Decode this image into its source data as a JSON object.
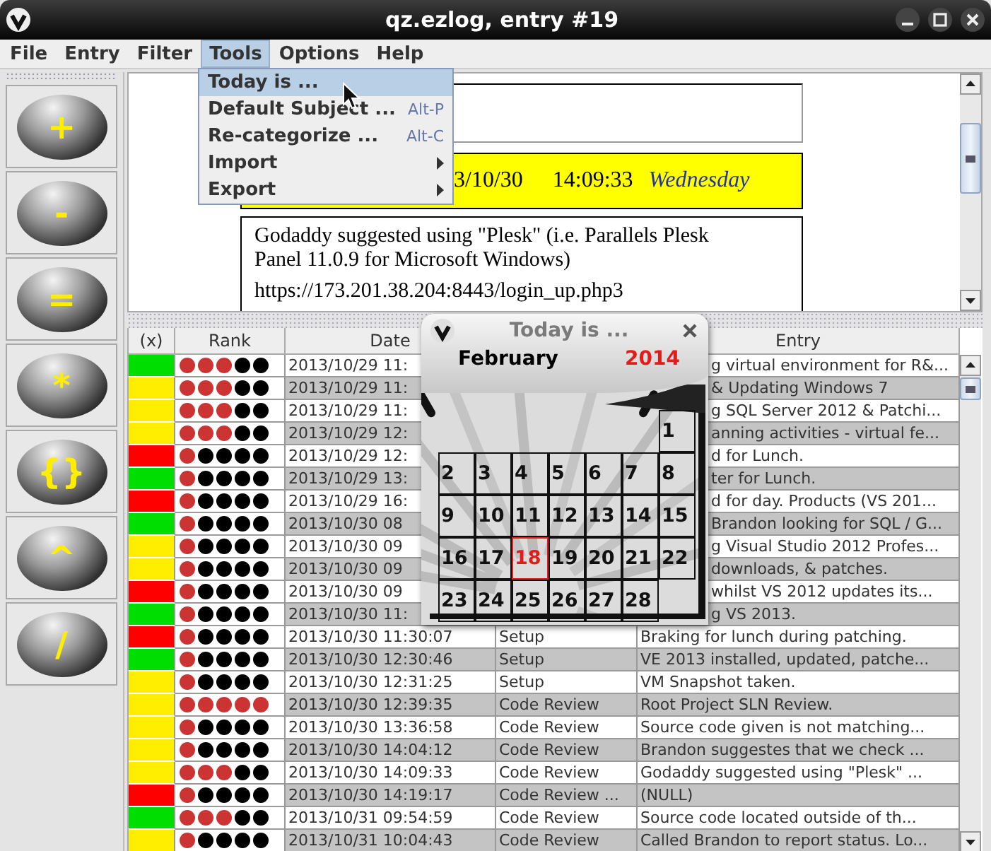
{
  "window": {
    "title": "qz.ezlog, entry #19"
  },
  "menu_bar": [
    {
      "label": "File",
      "selected": false
    },
    {
      "label": "Entry",
      "selected": false
    },
    {
      "label": "Filter",
      "selected": false
    },
    {
      "label": "Tools",
      "selected": true
    },
    {
      "label": "Options",
      "selected": false
    },
    {
      "label": "Help",
      "selected": false
    }
  ],
  "tools_menu": [
    {
      "label": "Today is ...",
      "selected": true,
      "submenu": false
    },
    {
      "label": "Default Subject ...",
      "shortcut": "Alt-P",
      "selected": false,
      "submenu": false
    },
    {
      "label": "Re-categorize ...",
      "shortcut": "Alt-C",
      "selected": false,
      "submenu": false
    },
    {
      "label": "Import",
      "selected": false,
      "submenu": true
    },
    {
      "label": "Export",
      "selected": false,
      "submenu": true
    }
  ],
  "toolbar": [
    "+",
    "-",
    "=",
    "*",
    "{}",
    "^",
    "/"
  ],
  "document": {
    "date": "3/10/30",
    "time": "14:09:33",
    "weekday": "Wednesday",
    "body": "Godaddy suggested using \"Plesk\" (i.e. Parallels Plesk Panel 11.0.9 for Microsoft Windows)",
    "link": "https://173.201.38.204:8443/login_up.php3"
  },
  "table": {
    "columns": [
      "(x)",
      "Rank",
      "Date",
      "Entry"
    ],
    "rows": [
      {
        "color": "#00dd00",
        "stars": 3,
        "date": "2013/10/29 11:",
        "entry": "g virtual environment for R&..."
      },
      {
        "color": "#ffee00",
        "stars": 3,
        "date": "2013/10/29 11:",
        "entry": "& Updating Windows 7"
      },
      {
        "color": "#ffee00",
        "stars": 3,
        "date": "2013/10/29 11:",
        "entry": "g SQL Server 2012 & Patchi..."
      },
      {
        "color": "#ffee00",
        "stars": 3,
        "date": "2013/10/29 12:",
        "entry": "anning activities - virtual fe..."
      },
      {
        "color": "#ff0000",
        "stars": 1,
        "date": "2013/10/29 12:",
        "entry": "d for Lunch."
      },
      {
        "color": "#00dd00",
        "stars": 1,
        "date": "2013/10/29 13:",
        "entry": "ter for Lunch."
      },
      {
        "color": "#ff0000",
        "stars": 1,
        "date": "2013/10/29 16:",
        "entry": "d for day. Products (VS 201..."
      },
      {
        "color": "#00dd00",
        "stars": 1,
        "date": "2013/10/30 08",
        "entry": "Brandon looking for SQL / G..."
      },
      {
        "color": "#ffee00",
        "stars": 1,
        "date": "2013/10/30 09",
        "entry": "g Visual Studio 2012 Profes..."
      },
      {
        "color": "#ffee00",
        "stars": 1,
        "date": "2013/10/30 09",
        "entry": "downloads, & patches."
      },
      {
        "color": "#ff0000",
        "stars": 1,
        "date": "2013/10/30 09",
        "entry": "whilst VS 2012 updates its..."
      },
      {
        "color": "#00dd00",
        "stars": 1,
        "date": "2013/10/30 11:",
        "entry": "g VS 2013."
      },
      {
        "color": "#ff0000",
        "stars": 1,
        "date": "2013/10/30 11:30:07",
        "category": "Setup",
        "entry": "Braking for lunch during patching."
      },
      {
        "color": "#00dd00",
        "stars": 1,
        "date": "2013/10/30 12:30:46",
        "category": "Setup",
        "entry": "VE 2013 installed, updated, patche..."
      },
      {
        "color": "#ffee00",
        "stars": 1,
        "date": "2013/10/30 12:31:25",
        "category": "Setup",
        "entry": "VM Snapshot taken."
      },
      {
        "color": "#ffee00",
        "stars": 5,
        "date": "2013/10/30 12:39:35",
        "category": "Code Review",
        "entry": "Root Project SLN Review."
      },
      {
        "color": "#ffee00",
        "stars": 1,
        "date": "2013/10/30 13:36:58",
        "category": "Code Review",
        "entry": "Source code given is not matching..."
      },
      {
        "color": "#ffee00",
        "stars": 1,
        "date": "2013/10/30 14:04:12",
        "category": "Code Review",
        "entry": "Brandon suggestes that we check ..."
      },
      {
        "color": "#ffee00",
        "stars": 3,
        "date": "2013/10/30 14:09:33",
        "category": "Code Review",
        "entry": "Godaddy suggested using \"Plesk\" ..."
      },
      {
        "color": "#ff0000",
        "stars": 1,
        "date": "2013/10/30 14:19:17",
        "category": "Code Review ...",
        "entry": "(NULL)"
      },
      {
        "color": "#00dd00",
        "stars": 3,
        "date": "2013/10/31 09:54:59",
        "category": "Code Review",
        "entry": "Source code located outside of th..."
      },
      {
        "color": "#ffee00",
        "stars": 1,
        "date": "2013/10/31 10:04:43",
        "category": "Code Review",
        "entry": "Called Brandon to report status. Lo..."
      }
    ]
  },
  "today_popup": {
    "title": "Today is ...",
    "month": "February",
    "year": "2014",
    "weeks": [
      [
        {
          "day": "1",
          "selected": false
        }
      ],
      [
        {
          "day": "2",
          "selected": false
        },
        {
          "day": "3",
          "selected": false
        },
        {
          "day": "4",
          "selected": false
        },
        {
          "day": "5",
          "selected": false
        },
        {
          "day": "6",
          "selected": false
        },
        {
          "day": "7",
          "selected": false
        },
        {
          "day": "8",
          "selected": false
        }
      ],
      [
        {
          "day": "9",
          "selected": false
        },
        {
          "day": "10",
          "selected": false
        },
        {
          "day": "11",
          "selected": false
        },
        {
          "day": "12",
          "selected": false
        },
        {
          "day": "13",
          "selected": false
        },
        {
          "day": "14",
          "selected": false
        },
        {
          "day": "15",
          "selected": false
        }
      ],
      [
        {
          "day": "16",
          "selected": false
        },
        {
          "day": "17",
          "selected": false
        },
        {
          "day": "18",
          "selected": true
        },
        {
          "day": "19",
          "selected": false
        },
        {
          "day": "20",
          "selected": false
        },
        {
          "day": "21",
          "selected": false
        },
        {
          "day": "22",
          "selected": false
        }
      ],
      [
        {
          "day": "23",
          "selected": false
        },
        {
          "day": "24",
          "selected": false
        },
        {
          "day": "25",
          "selected": false
        },
        {
          "day": "26",
          "selected": false
        },
        {
          "day": "27",
          "selected": false
        },
        {
          "day": "28",
          "selected": false
        }
      ]
    ]
  }
}
